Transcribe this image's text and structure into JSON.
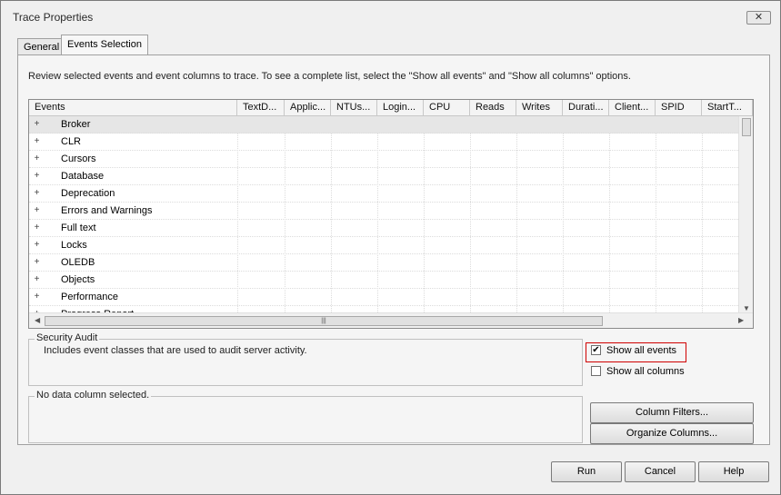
{
  "window": {
    "title": "Trace Properties",
    "close_glyph": "✕"
  },
  "tabs": [
    {
      "label": "General",
      "active": false
    },
    {
      "label": "Events Selection",
      "active": true
    }
  ],
  "info_text": "Review selected events and event columns to trace. To see a complete list, select the \"Show all events\" and \"Show all columns\" options.",
  "grid": {
    "columns": [
      "Events",
      "TextD...",
      "Applic...",
      "NTUs...",
      "Login...",
      "CPU",
      "Reads",
      "Writes",
      "Durati...",
      "Client...",
      "SPID",
      "StartT..."
    ],
    "rows": [
      {
        "expander": "+",
        "label": "Broker"
      },
      {
        "expander": "+",
        "label": "CLR"
      },
      {
        "expander": "+",
        "label": "Cursors"
      },
      {
        "expander": "+",
        "label": "Database"
      },
      {
        "expander": "+",
        "label": "Deprecation"
      },
      {
        "expander": "+",
        "label": "Errors and Warnings"
      },
      {
        "expander": "+",
        "label": "Full text"
      },
      {
        "expander": "+",
        "label": "Locks"
      },
      {
        "expander": "+",
        "label": "OLEDB"
      },
      {
        "expander": "+",
        "label": "Objects"
      },
      {
        "expander": "+",
        "label": "Performance"
      },
      {
        "expander": "+",
        "label": "Progress Report"
      }
    ],
    "selected_row": 0,
    "hscroll_grip": "|||"
  },
  "security_audit": {
    "title": "Security Audit",
    "description": "Includes event classes that are used to audit server activity."
  },
  "column_info": {
    "title": "No data column selected."
  },
  "options": {
    "show_all_events": {
      "label": "Show all events",
      "checked": true,
      "check_glyph": "✔"
    },
    "show_all_columns": {
      "label": "Show all columns",
      "checked": false
    }
  },
  "buttons": {
    "column_filters": "Column Filters...",
    "organize_columns": "Organize Columns...",
    "run": "Run",
    "cancel": "Cancel",
    "help": "Help"
  },
  "colors": {
    "highlight": "#d00000",
    "selected_row": "#e6e6e6"
  }
}
